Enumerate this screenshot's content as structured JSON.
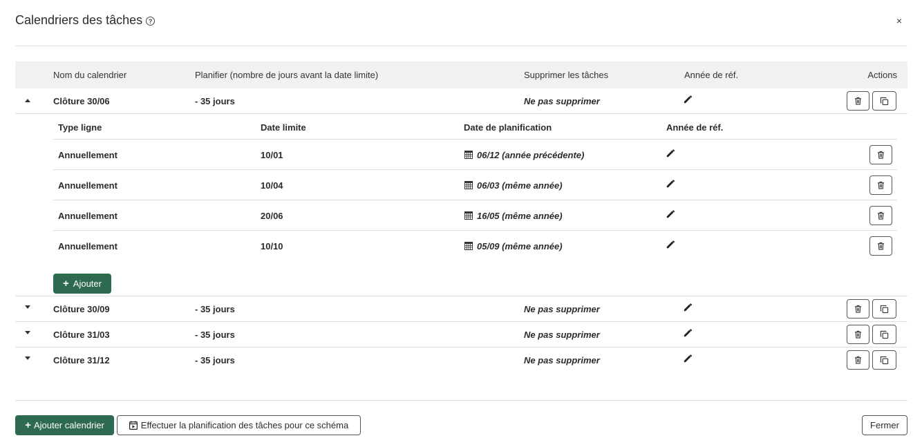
{
  "modal": {
    "title": "Calendriers des tâches",
    "close": "×"
  },
  "table": {
    "headers": {
      "name": "Nom du calendrier",
      "plan": "Planifier (nombre de jours avant la date limite)",
      "delete_tasks": "Supprimer les tâches",
      "ref_year": "Année de réf.",
      "actions": "Actions"
    },
    "calendars": [
      {
        "name": "Clôture 30/06",
        "plan": "- 35 jours",
        "delete_tasks": "Ne pas supprimer",
        "expanded": true
      },
      {
        "name": "Clôture 30/09",
        "plan": "- 35 jours",
        "delete_tasks": "Ne pas supprimer",
        "expanded": false
      },
      {
        "name": "Clôture 31/03",
        "plan": "- 35 jours",
        "delete_tasks": "Ne pas supprimer",
        "expanded": false
      },
      {
        "name": "Clôture 31/12",
        "plan": "- 35 jours",
        "delete_tasks": "Ne pas supprimer",
        "expanded": false
      }
    ],
    "subtable": {
      "headers": {
        "type": "Type ligne",
        "deadline": "Date limite",
        "planning_date": "Date de planification",
        "ref_year": "Année de réf."
      },
      "rows": [
        {
          "type": "Annuellement",
          "deadline": "10/01",
          "planning_date": "06/12 (année précédente)"
        },
        {
          "type": "Annuellement",
          "deadline": "10/04",
          "planning_date": "06/03 (même année)"
        },
        {
          "type": "Annuellement",
          "deadline": "20/06",
          "planning_date": "16/05 (même année)"
        },
        {
          "type": "Annuellement",
          "deadline": "10/10",
          "planning_date": "05/09 (même année)"
        }
      ],
      "add_label": "Ajouter"
    }
  },
  "footer": {
    "add_calendar": "Ajouter calendrier",
    "run_planning": "Effectuer la planification des tâches pour ce schéma",
    "close": "Fermer"
  },
  "colors": {
    "primary": "#2d6a4f",
    "header_bg": "#f1f1f1",
    "border": "#dedede"
  },
  "icons": {
    "help": "help-circle-icon",
    "edit": "pencil-icon",
    "delete": "trash-icon",
    "copy": "copy-icon",
    "calendar": "calendar-grid-icon",
    "planning": "calendar-play-icon"
  }
}
